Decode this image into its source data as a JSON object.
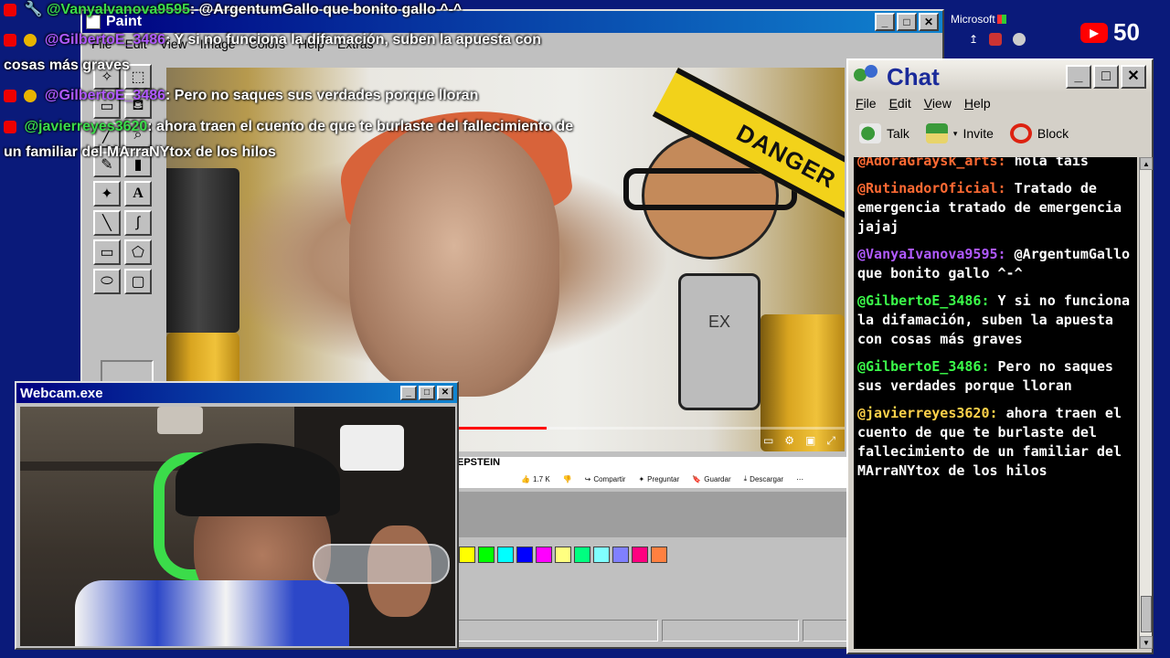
{
  "paint": {
    "title": "Paint",
    "menu": [
      "File",
      "Edit",
      "View",
      "Image",
      "Colors",
      "Help",
      "Extras"
    ],
    "tools": [
      "select-star",
      "select-rect",
      "eraser",
      "fill",
      "picker",
      "zoom",
      "pencil",
      "brush",
      "airbrush",
      "text",
      "line",
      "curve",
      "rectangle",
      "polygon",
      "ellipse",
      "rounded-rect"
    ],
    "text_tool_glyph": "A",
    "video": {
      "danger_text": "DANGER",
      "shirt_text": "EX",
      "progress_percent": 56
    },
    "youtube": {
      "title_fragment": "EPSTEIN",
      "likes": "1.7 K",
      "share": "Compartir",
      "ask": "Preguntar",
      "save": "Guardar",
      "download": "Descargar"
    },
    "palette": [
      "#ffff00",
      "#00ff00",
      "#00ffff",
      "#0000ff",
      "#ff00ff",
      "#ffff80",
      "#00ff80",
      "#80ffff",
      "#8080ff",
      "#ff0080",
      "#ff8040"
    ]
  },
  "overlay_chat": [
    {
      "user": "@VanyaIvanova9595",
      "text": ": @ArgentumGallo que bonito gallo ^-^",
      "color": "#3bdc4a"
    },
    {
      "user": "@GilbertoE_3486",
      "text": ": Y si no funciona la difamación, suben la apuesta con",
      "cont": "cosas más graves",
      "color": "#b05aff"
    },
    {
      "user": "@GilbertoE_3486",
      "text": ": Pero no saques sus verdades porque lloran",
      "color": "#b05aff"
    },
    {
      "user": "@javierreyes3620",
      "text": ": ahora traen el cuento de que te burlaste del fallecimiento de",
      "cont": "un familiar del MArraNYtox de los hilos",
      "color": "#3bdc4a"
    }
  ],
  "tray": {
    "microsoft_label": "Microsoft",
    "yt_count": "50"
  },
  "webcam": {
    "title": "Webcam.exe"
  },
  "chat": {
    "title": "Chat",
    "menu": [
      "File",
      "Edit",
      "View",
      "Help"
    ],
    "tools": {
      "talk": "Talk",
      "invite": "Invite",
      "block": "Block"
    },
    "messages": [
      {
        "user": "@AdoraGraysk_arts:",
        "text": "hola tais",
        "color": "orange"
      },
      {
        "user": "@RutinadorOficial:",
        "text": "Tratado de emergencia tratado de emergencia jajaj",
        "color": "orange"
      },
      {
        "user": "@VanyaIvanova9595:",
        "text": "@ArgentumGallo que bonito gallo ^-^",
        "color": "purple"
      },
      {
        "user": "@GilbertoE_3486:",
        "text": "Y si no funciona la difamación, suben la apuesta con cosas más graves",
        "color": "green"
      },
      {
        "user": "@GilbertoE_3486:",
        "text": "Pero no saques sus verdades porque lloran",
        "color": "green"
      },
      {
        "user": "@javierreyes3620:",
        "text": "ahora traen el cuento de que te burlaste del fallecimiento de un familiar del MArraNYtox de los hilos",
        "color": "gold"
      }
    ]
  },
  "colors": {
    "desktop": "#0a1a7a",
    "titlebar_start": "#000080",
    "titlebar_end": "#1084d0",
    "chat_green": "#3bff4a",
    "chat_purple": "#b05aff",
    "chat_orange": "#ff6a33",
    "chat_gold": "#ffd24a"
  }
}
